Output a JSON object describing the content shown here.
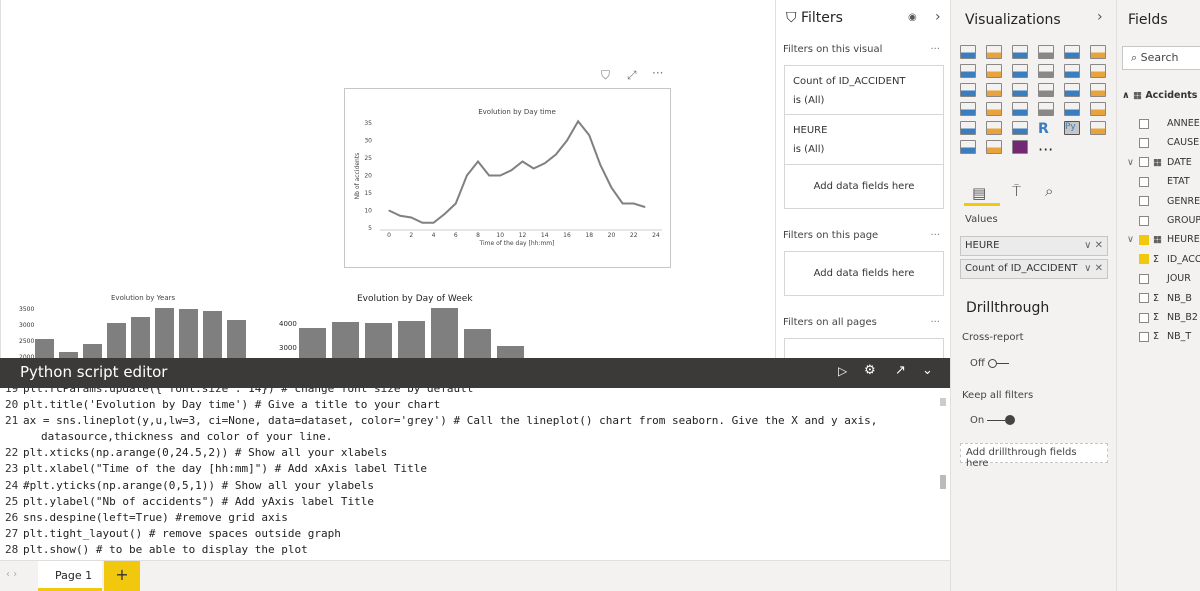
{
  "filters": {
    "title": "Filters",
    "on_visual": "Filters on this visual",
    "cards": [
      {
        "field": "Count of ID_ACCIDENT",
        "state": "is (All)"
      },
      {
        "field": "HEURE",
        "state": "is (All)"
      }
    ],
    "add_fields": "Add data fields here",
    "on_page": "Filters on this page",
    "on_all": "Filters on all pages",
    "more": "···"
  },
  "visualizations": {
    "title": "Visualizations",
    "values_label": "Values",
    "values": [
      "HEURE",
      "Count of ID_ACCIDENT"
    ],
    "drillthrough": "Drillthrough",
    "cross_report": "Cross-report",
    "cross_report_state": "Off",
    "keep_filters": "Keep all filters",
    "keep_filters_state": "On",
    "add_drill": "Add drillthrough fields here",
    "r_label": "R",
    "py_label": "Py",
    "more": "···"
  },
  "fields": {
    "title": "Fields",
    "search_placeholder": "Search",
    "table": "Accidents",
    "items": [
      {
        "name": "ANNEE",
        "checked": false,
        "type": ""
      },
      {
        "name": "CAUSE",
        "checked": false,
        "type": ""
      },
      {
        "name": "DATE",
        "checked": false,
        "type": "date",
        "expand": true
      },
      {
        "name": "ETAT",
        "checked": false,
        "type": ""
      },
      {
        "name": "GENRE",
        "checked": false,
        "type": ""
      },
      {
        "name": "GROUPE",
        "checked": false,
        "type": ""
      },
      {
        "name": "HEURE",
        "checked": true,
        "type": "date",
        "expand": true
      },
      {
        "name": "ID_ACCIDENT",
        "checked": true,
        "type": "sigma"
      },
      {
        "name": "JOUR",
        "checked": false,
        "type": ""
      },
      {
        "name": "NB_B",
        "checked": false,
        "type": "sigma"
      },
      {
        "name": "NB_B2",
        "checked": false,
        "type": "sigma"
      },
      {
        "name": "NB_T",
        "checked": false,
        "type": "sigma"
      }
    ]
  },
  "editor": {
    "title": "Python script editor",
    "lines": [
      {
        "n": "19",
        "code": "plt.rcParams.update({'font.size': 14}) # change font size by default"
      },
      {
        "n": "20",
        "code": "plt.title('Evolution by Day time') # Give a title to your chart"
      },
      {
        "n": "21",
        "code": "ax = sns.lineplot(y,u,lw=3, ci=None, data=dataset, color='grey') # Call the lineplot() chart from seaborn. Give the X and y axis,"
      },
      {
        "n": "",
        "code": "datasource,thickness and color of your line."
      },
      {
        "n": "22",
        "code": "plt.xticks(np.arange(0,24.5,2)) # Show all your xlabels"
      },
      {
        "n": "23",
        "code": "plt.xlabel(\"Time of the day  [hh:mm]\") # Add xAxis label Title"
      },
      {
        "n": "24",
        "code": "#plt.yticks(np.arange(0,5,1)) # Show all your ylabels"
      },
      {
        "n": "25",
        "code": "plt.ylabel(\"Nb of accidents\") # Add yAxis label Title"
      },
      {
        "n": "26",
        "code": "sns.despine(left=True) #remove grid axis"
      },
      {
        "n": "27",
        "code": "plt.tight_layout() # remove spaces outside graph"
      },
      {
        "n": "28",
        "code": "plt.show() # to be able to display the plot"
      }
    ]
  },
  "tabs": {
    "page": "Page 1",
    "add": "+"
  },
  "bg_charts": {
    "years_title": "Evolution by Years",
    "years_ticks": [
      "3500",
      "3000",
      "2500",
      "2000"
    ],
    "week_title": "Evolution by Day of Week",
    "week_ticks": [
      "4000",
      "3000"
    ],
    "week_ylabel": "cidents",
    "years_ylabel": "cidents"
  },
  "chart_data": {
    "type": "line",
    "title": "Evolution by Day time",
    "xlabel": "Time of the day  [hh:mm]",
    "ylabel": "Nb of accidents",
    "x": [
      0,
      1,
      2,
      3,
      4,
      5,
      6,
      7,
      8,
      9,
      10,
      11,
      12,
      13,
      14,
      15,
      16,
      17,
      18,
      19,
      20,
      21,
      22,
      23
    ],
    "values": [
      10,
      8.5,
      8,
      6.5,
      6.5,
      9,
      12,
      20,
      24,
      20,
      20,
      21.5,
      24,
      22,
      23.5,
      26,
      30,
      35.5,
      31.5,
      23,
      16.5,
      12,
      12,
      11
    ],
    "xticks": [
      0,
      2,
      4,
      6,
      8,
      10,
      12,
      14,
      16,
      18,
      20,
      22,
      24
    ],
    "yticks": [
      5,
      10,
      15,
      20,
      25,
      30,
      35
    ],
    "xlim": [
      0,
      24
    ],
    "ylim": [
      5,
      35
    ],
    "color": "#808080",
    "grid": false
  }
}
